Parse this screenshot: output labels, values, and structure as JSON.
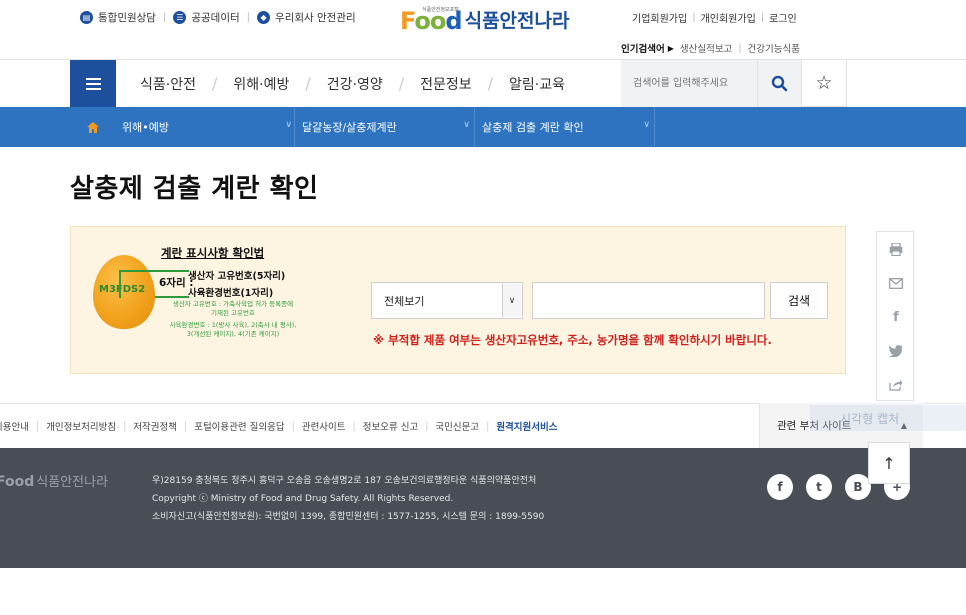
{
  "top_utility": {
    "items": [
      {
        "label": "통합민원상담",
        "icon": "document-icon"
      },
      {
        "label": "공공데이터",
        "icon": "list-icon"
      },
      {
        "label": "우리회사 안전관리",
        "icon": "shield-icon"
      }
    ]
  },
  "logo": {
    "tagline": "식품안전정보포털",
    "brand": "Food",
    "name": "식품안전나라"
  },
  "account_links": [
    "기업회원가입",
    "개인회원가입",
    "로그인"
  ],
  "popular": {
    "label": "인기검색어",
    "items": [
      "생산실적보고",
      "건강기능식품"
    ]
  },
  "main_nav": {
    "items": [
      "식품·안전",
      "위해·예방",
      "건강·영양",
      "전문정보",
      "알림·교육"
    ],
    "search_placeholder": "검색어를 입력해주세요"
  },
  "breadcrumb": [
    "위해•예방",
    "달걀농장/살충제계란",
    "살충제 검출 계란 확인"
  ],
  "page_title": "살충제 검출 계란 확인",
  "guide": {
    "title": "계란 표시사항 확인법",
    "egg_code": "M3FDS2",
    "six_digit": "6자리 :",
    "producer": "생산자 고유번호(5자리)",
    "farm": "사육환경번호(1자리)",
    "producer_note_1": "생산자 고유번호 : 가축사육업 허가 등록증에",
    "producer_note_2": "기재된 고유번호",
    "farm_note_1": "사육환경번호 : 1(방사 사육), 2(축사 내 평사),",
    "farm_note_2": "3(개선된 케이지), 4(기존 케이지)"
  },
  "search_form": {
    "select_value": "전체보기",
    "query_value": "",
    "submit_label": "검색",
    "warning": "※ 부적합 제품 여부는 생산자고유번호, 주소, 농가명을 함께 확인하시기 바랍니다."
  },
  "side_tools": [
    "print-icon",
    "mail-icon",
    "facebook-icon",
    "twitter-icon",
    "share-icon"
  ],
  "footer_links": {
    "items": [
      "이용안내",
      "개인정보처리방침",
      "저작권정책",
      "포털이용관련 질의응답",
      "관련사이트",
      "정보오류 신고",
      "국민신문고"
    ],
    "highlight": "원격지원서비스"
  },
  "related_sites": {
    "label": "관련 부처 사이트"
  },
  "ghost_overlay": "시각형 캡처",
  "footer": {
    "brand": "Food",
    "name": "식품안전나라",
    "address": "우)28159 충청북도 청주시 흥덕구 오송읍 오송생명2로 187 오송보건의료행정타운 식품의약품안전처",
    "copyright": "Copyright ⓒ Ministry of Food and Drug Safety. All Rights Reserved.",
    "contact": "소비자신고(식품안전정보원): 국번없이 1399, 종합민원센터 : 1577-1255, 시스템 문의 : 1899-5590"
  },
  "social": [
    "f",
    "t",
    "B",
    "+"
  ],
  "to_top": "↑",
  "colors": {
    "primary": "#1d4f9c",
    "crumb": "#2d73c0",
    "warning": "#d0211d",
    "panel": "#fdf5e2",
    "footer": "#494d55"
  }
}
